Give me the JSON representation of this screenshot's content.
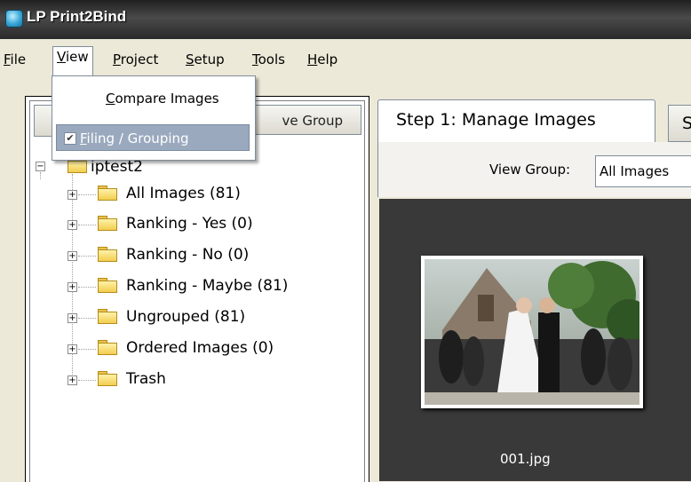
{
  "window": {
    "title": "LP Print2Bind"
  },
  "menubar": {
    "items": [
      {
        "label": "ile",
        "mnemonic": "F"
      },
      {
        "label": "iew",
        "mnemonic": "V"
      },
      {
        "label": "roject",
        "mnemonic": "P"
      },
      {
        "label": "etup",
        "mnemonic": "S"
      },
      {
        "label": "ools",
        "mnemonic": "T"
      },
      {
        "label": "elp",
        "mnemonic": "H"
      }
    ]
  },
  "view_menu": {
    "items": [
      {
        "mnemonic": "C",
        "rest": "ompare Images",
        "checked": false
      },
      {
        "mnemonic": "F",
        "rest": "iling / Grouping",
        "checked": true
      }
    ]
  },
  "left_panel": {
    "add_button_partial": "",
    "remove_button_partial": "ve Group",
    "root": "iptest2",
    "tree_items": [
      "All Images (81)",
      "Ranking - Yes (0)",
      "Ranking - No (0)",
      "Ranking - Maybe (81)",
      "Ungrouped (81)",
      "Ordered Images (0)",
      "Trash"
    ]
  },
  "right_panel": {
    "active_tab": "Step 1: Manage Images",
    "next_tab_partial": "S",
    "view_group_label": "View Group:",
    "view_group_value": "All Images",
    "thumbnail_caption": "001.jpg"
  }
}
